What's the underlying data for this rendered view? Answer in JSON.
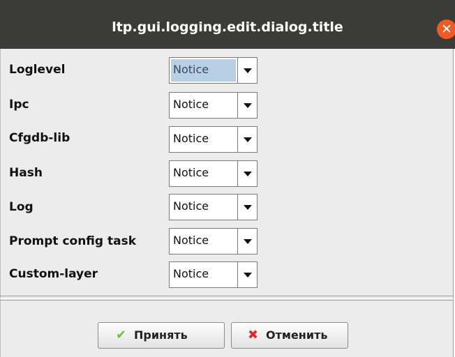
{
  "window": {
    "title": "ltp.gui.logging.edit.dialog.title",
    "close_glyph": "✕"
  },
  "rows": [
    {
      "label": "Loglevel",
      "value": "Notice",
      "focused": true
    },
    {
      "label": "Ipc",
      "value": "Notice"
    },
    {
      "label": "Cfgdb-lib",
      "value": "Notice"
    },
    {
      "label": "Hash",
      "value": "Notice"
    },
    {
      "label": "Log",
      "value": "Notice"
    },
    {
      "label": "Prompt config task",
      "value": "Notice"
    },
    {
      "label": "Custom-layer",
      "value": "Notice"
    }
  ],
  "buttons": {
    "accept": {
      "label": "Принять",
      "icon": "check-icon",
      "glyph": "✔",
      "color": "#6fbf3a"
    },
    "cancel": {
      "label": "Отменить",
      "icon": "x-icon",
      "glyph": "✖",
      "color": "#e02828"
    }
  },
  "colors": {
    "titlebar": "#3b3b37",
    "close": "#ee5b24",
    "selection": "#b8cfe6",
    "panel": "#ececec"
  }
}
